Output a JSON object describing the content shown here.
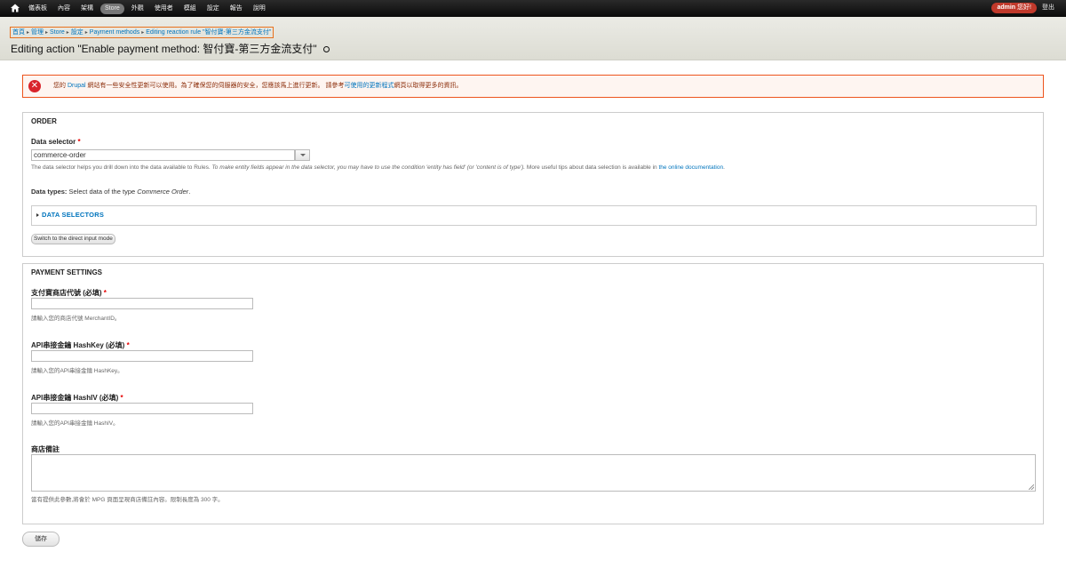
{
  "toolbar": {
    "menu": [
      "儀表板",
      "內容",
      "架構",
      "Store",
      "外觀",
      "使用者",
      "模組",
      "設定",
      "報告",
      "說明"
    ],
    "user_name": "admin",
    "user_greeting": "您好!",
    "logout": "登出"
  },
  "breadcrumb": [
    "首頁",
    "管理",
    "Store",
    "設定",
    "Payment methods",
    "Editing reaction rule \"智付寶-第三方金流支付\""
  ],
  "page_title": "Editing action \"Enable payment method: 智付寶-第三方金流支付\"",
  "message": {
    "part1": "您的 ",
    "drupal": "Drupal",
    "part2": " 網站有一些安全性更新可以使用。為了確保您的伺服器的安全，您應該馬上進行更新。 請參考",
    "link": "可使用的更新程式",
    "part3": "網頁以取得更多的資訊。"
  },
  "order": {
    "legend": "ORDER",
    "data_selector_label": "Data selector",
    "required_mark": "*",
    "data_selector_value": "commerce-order",
    "desc_1": "The data selector helps you drill down into the data available to Rules. ",
    "desc_em": "To make entity fields appear in the data selector, you may have to use the condition 'entity has field' (or 'content is of type').",
    "desc_2": " More useful tips about data selection is available in ",
    "desc_link": "the online documentation",
    "desc_3": ".",
    "data_types_label": "Data types:",
    "data_types_text": " Select data of the type ",
    "data_types_em": "Commerce Order",
    "data_types_end": ".",
    "data_selectors_toggle": "DATA SELECTORS",
    "switch_button": "Switch to the direct input mode"
  },
  "payment": {
    "legend": "PAYMENT SETTINGS",
    "merchant_label": "支付寶商店代號 (必填)",
    "merchant_desc": "請輸入您的商店代號 MerchantID。",
    "hashkey_label": "API串接金鑰 HashKey (必填)",
    "hashkey_desc": "請輸入您的API串接金鑰 HashKey。",
    "hashiv_label": "API串接金鑰 HashIV (必填)",
    "hashiv_desc": "請輸入您的API串接金鑰 HashIV。",
    "memo_label": "商店備註",
    "memo_desc": "當有提供此參數,將會於 MPG 頁面呈現商店備註內容。限制長度為 300 字。",
    "required_mark": "*"
  },
  "save_button": "儲存",
  "colors": {
    "accent_link": "#0074bd",
    "error_border": "#ed541d",
    "breadcrumb_highlight": "#e8711d"
  }
}
